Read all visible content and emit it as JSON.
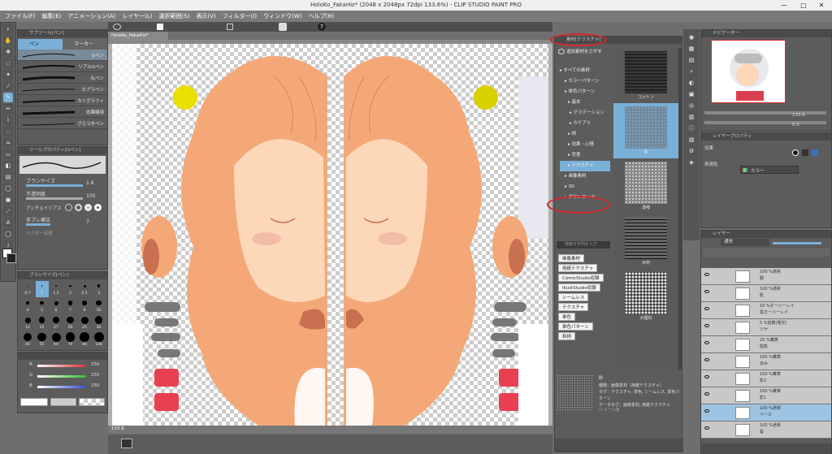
{
  "window": {
    "title": "HoloKo_FakaHiz* (2048 x 2048px 72dpi 133.6%) - CLIP STUDIO PAINT PRO",
    "controls": [
      "—",
      "□",
      "✕"
    ]
  },
  "menu": [
    "ファイル(F)",
    "編集(E)",
    "アニメーション(A)",
    "レイヤー(L)",
    "選択範囲(S)",
    "表示(V)",
    "フィルター(I)",
    "ウィンドウ(W)",
    "ヘルプ(H)"
  ],
  "document_tab": "HoloKo_FakaHiz*",
  "subtool_panel": {
    "title": "サブツール[ペン]",
    "tabs": [
      "ペン",
      "マーカー"
    ],
    "items": [
      "Gペン",
      "リアルGペン",
      "丸ペン",
      "カブラペン",
      "カリグラフィ",
      "効果線用",
      "ざらつきペン"
    ]
  },
  "tool_property": {
    "title": "ツールプロパティ[Gペン]",
    "brush_size_label": "ブラシサイズ",
    "brush_size_value": "1.8",
    "opacity_label": "不透明度",
    "opacity_value": "100",
    "antialias_label": "アンチエイリアス",
    "stabilization_label": "手ブレ補正",
    "stabilization_value": "7",
    "vector_label": "ベクター吸着"
  },
  "brush_size_panel": {
    "title": "ブラシサイズ[ペン]",
    "sizes": [
      "0.7",
      "1",
      "1.5",
      "2",
      "2.5",
      "3",
      "4",
      "5",
      "6",
      "7",
      "8",
      "10",
      "12",
      "15",
      "17",
      "20",
      "25",
      "30",
      "40",
      "50",
      "60",
      "70",
      "80",
      "100"
    ]
  },
  "color_panel": {
    "channels": [
      {
        "label": "R",
        "value": "250",
        "color": "#e03030"
      },
      {
        "label": "G",
        "value": "250",
        "color": "#30c030"
      },
      {
        "label": "B",
        "value": "250",
        "color": "#3050e0"
      }
    ]
  },
  "material_panel": {
    "title": "素材[テクスチャ]",
    "add_button": "追加素材をさがす",
    "tree": [
      "すべての素材",
      "カラーパターン",
      "単色パターン",
      "基本",
      "グラデーション",
      "カケアミ",
      "柄",
      "効果・心情",
      "背景",
      "テクスチャ",
      "画像素材",
      "3D",
      "ダウンロード"
    ],
    "search_placeholder": "検索文字列を入力",
    "tags": [
      "画像素材",
      "用紙テクスチャ",
      "ComicStudio収録",
      "IllustStudio収録",
      "シームレス",
      "テクスチャ",
      "単色",
      "単色パターン",
      "和柄"
    ],
    "thumbnails": [
      "コットン",
      "砂",
      "漆喰",
      "木材",
      "大理石"
    ],
    "selected_thumbnail": "砂",
    "info_title": "砂",
    "info_lines": [
      "種類：画像素材（用紙テクスチャ）",
      "タグ：テクスチャ, 単色, シームレス, 単色パターン",
      "データタグ：画像素材, 用紙テクスチャ"
    ],
    "tone_label": "トーン化"
  },
  "navigator": {
    "title": "ナビゲーター",
    "zoom": "133.6",
    "angle": "0.0"
  },
  "layer_property": {
    "title": "レイヤープロパティ",
    "effect_label": "効果",
    "expression_label": "表現色",
    "expression_value": "カラー"
  },
  "layers_panel": {
    "title": "レイヤー",
    "blend_mode": "通常",
    "opacity": "100",
    "rows": [
      {
        "name": "100 %通常",
        "sub": "服"
      },
      {
        "name": "100 %通常",
        "sub": "肌"
      },
      {
        "name": "10 %オーバーレイ",
        "sub": "黒オーバーレイ"
      },
      {
        "name": "5 %加算(発光)",
        "sub": "ツヤ"
      },
      {
        "name": "25 %乗算",
        "sub": "陰影"
      },
      {
        "name": "100 %乗算",
        "sub": "赤み"
      },
      {
        "name": "100 %乗算",
        "sub": "影2"
      },
      {
        "name": "100 %乗算",
        "sub": "影1"
      },
      {
        "name": "100 %通常",
        "sub": "ベース"
      },
      {
        "name": "100 %通常",
        "sub": "髪"
      }
    ],
    "selected_index": 8
  },
  "status": {
    "zoom_left": "133.6",
    "coords": "0.0"
  },
  "colors": {
    "skin": "#f4a878",
    "skin_light": "#fcd8b8",
    "yellow": "#e0d800",
    "blush_dark": "#c87050",
    "red": "#e84050",
    "accent": "#7ab0d8",
    "highlight_ring": "#d62828"
  }
}
